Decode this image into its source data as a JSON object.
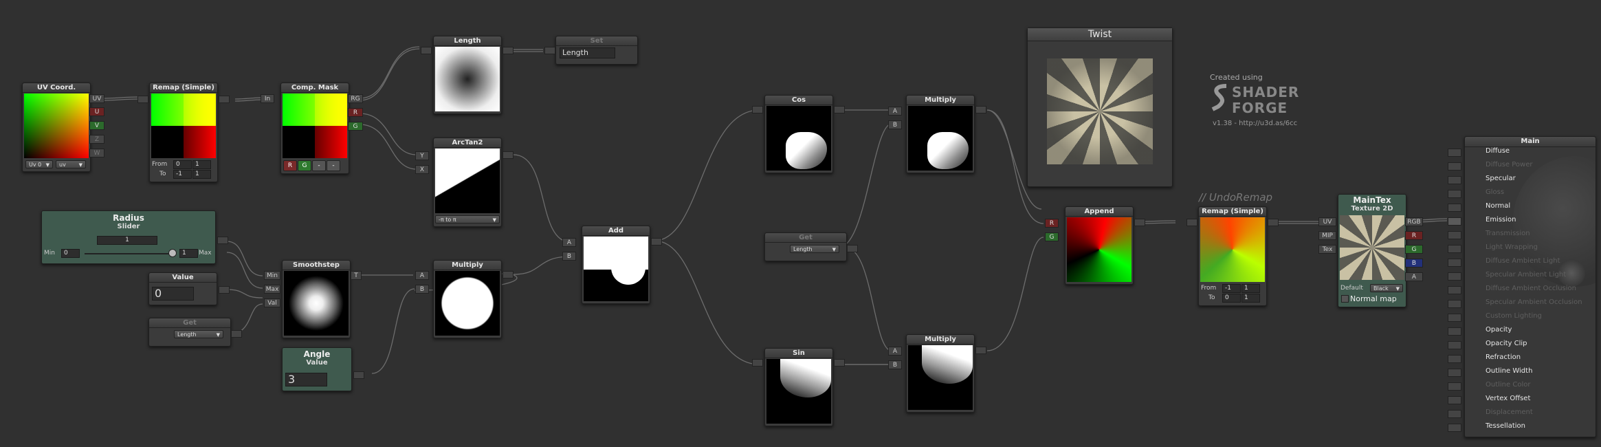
{
  "nodes": {
    "uv": {
      "title": "UV Coord.",
      "ports": [
        "UV",
        "U",
        "V",
        "Z",
        "W"
      ],
      "uv_channel": "Uv 0",
      "uv_mode": "uv"
    },
    "remap1": {
      "title": "Remap (Simple)",
      "from_label": "From",
      "from_a": "0",
      "from_b": "1",
      "to_label": "To",
      "to_a": "-1",
      "to_b": "1",
      "in_port": "In"
    },
    "mask": {
      "title": "Comp. Mask",
      "ports": [
        "RG",
        "R",
        "G"
      ],
      "btn_r": "R",
      "btn_g": "G",
      "btn_3": "-",
      "btn_4": "-"
    },
    "length": {
      "title": "Length"
    },
    "set": {
      "title": "Set",
      "value": "Length"
    },
    "arctan": {
      "title": "ArcTan2",
      "ports": [
        "Y",
        "X"
      ],
      "mode": "-π to π"
    },
    "radius": {
      "title": "Radius",
      "subtitle": "Slider",
      "value": "1",
      "min_label": "Min",
      "min_val": "0",
      "max_label": "Max",
      "max_val": "1"
    },
    "value": {
      "title": "Value",
      "value": "0"
    },
    "get1": {
      "title": "Get",
      "value": "Length"
    },
    "angle": {
      "title": "Angle",
      "subtitle": "Value",
      "value": "3"
    },
    "smooth": {
      "title": "Smoothstep",
      "ports": [
        "Min",
        "Max",
        "Val"
      ],
      "out": "T"
    },
    "mult1": {
      "title": "Multiply",
      "ports": [
        "A",
        "B"
      ]
    },
    "add": {
      "title": "Add",
      "ports": [
        "A",
        "B"
      ]
    },
    "cos": {
      "title": "Cos"
    },
    "sin": {
      "title": "Sin"
    },
    "get2": {
      "title": "Get",
      "value": "Length"
    },
    "mult2": {
      "title": "Multiply",
      "ports": [
        "A",
        "B"
      ]
    },
    "mult3": {
      "title": "Multiply",
      "ports": [
        "A",
        "B"
      ]
    },
    "twist": {
      "title": "Twist"
    },
    "append": {
      "title": "Append",
      "ports": [
        "R",
        "G"
      ]
    },
    "remap2": {
      "title": "Remap (Simple)",
      "comment": "// UndoRemap",
      "from_label": "From",
      "from_a": "-1",
      "from_b": "1",
      "to_label": "To",
      "to_a": "0",
      "to_b": "1"
    },
    "maintex": {
      "title": "MainTex",
      "subtitle": "Texture 2D",
      "ports_in": [
        "UV",
        "MIP",
        "Tex"
      ],
      "ports_out": [
        "RGB",
        "R",
        "G",
        "B",
        "A"
      ],
      "default_label": "Default",
      "color_value": "Black",
      "normal_label": "Normal map"
    }
  },
  "branding": {
    "created": "Created using",
    "logo_line1": "SHADER",
    "logo_line2": "FORGE",
    "version": "v1.38 - http://u3d.as/6cc"
  },
  "main": {
    "title": "Main",
    "inputs": [
      {
        "label": "Diffuse",
        "enabled": true,
        "connected": false
      },
      {
        "label": "Diffuse Power",
        "enabled": false,
        "connected": false
      },
      {
        "label": "Specular",
        "enabled": true,
        "connected": false
      },
      {
        "label": "Gloss",
        "enabled": false,
        "connected": false
      },
      {
        "label": "Normal",
        "enabled": true,
        "connected": false
      },
      {
        "label": "Emission",
        "enabled": true,
        "connected": true
      },
      {
        "label": "Transmission",
        "enabled": false,
        "connected": false
      },
      {
        "label": "Light Wrapping",
        "enabled": false,
        "connected": false
      },
      {
        "label": "Diffuse Ambient Light",
        "enabled": false,
        "connected": false
      },
      {
        "label": "Specular Ambient Light",
        "enabled": false,
        "connected": false
      },
      {
        "label": "Diffuse Ambient Occlusion",
        "enabled": false,
        "connected": false
      },
      {
        "label": "Specular Ambient Occlusion",
        "enabled": false,
        "connected": false
      },
      {
        "label": "Custom Lighting",
        "enabled": false,
        "connected": false
      },
      {
        "label": "Opacity",
        "enabled": true,
        "connected": false
      },
      {
        "label": "Opacity Clip",
        "enabled": true,
        "connected": false
      },
      {
        "label": "Refraction",
        "enabled": true,
        "connected": false
      },
      {
        "label": "Outline Width",
        "enabled": true,
        "connected": false
      },
      {
        "label": "Outline Color",
        "enabled": false,
        "connected": false
      },
      {
        "label": "Vertex Offset",
        "enabled": true,
        "connected": false
      },
      {
        "label": "Displacement",
        "enabled": false,
        "connected": false
      },
      {
        "label": "Tessellation",
        "enabled": true,
        "connected": false
      }
    ]
  },
  "colors": {
    "canvas": "#303030",
    "wire": "#6e6e6e",
    "node": "#3b3b3b",
    "green_node": "#3f5a4e"
  },
  "icons": {
    "logo": "shader-forge-logo-icon",
    "slider_knob": "slider-knob-icon"
  }
}
